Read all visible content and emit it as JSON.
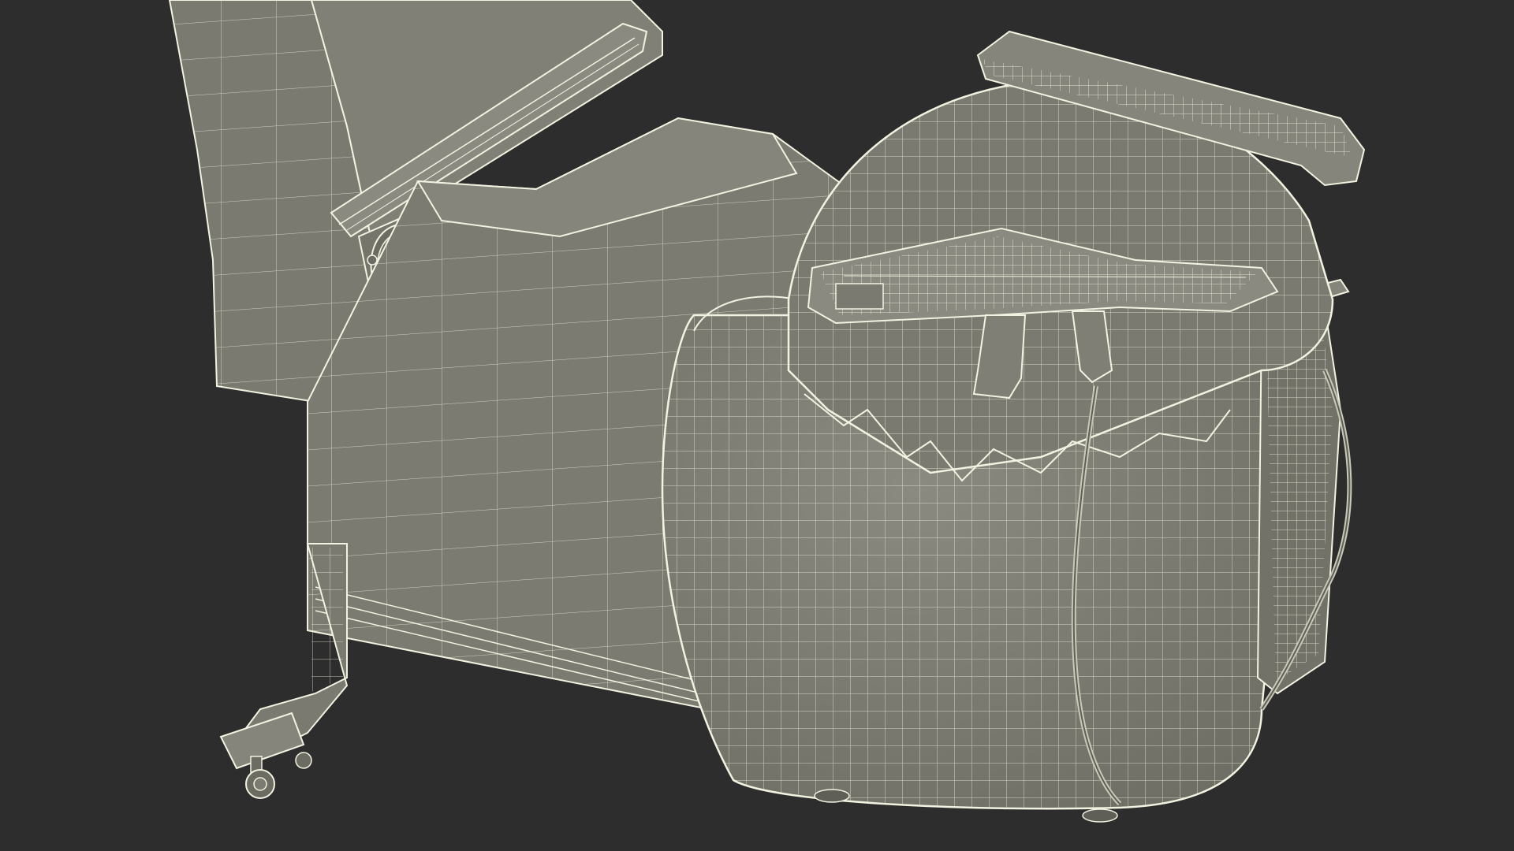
{
  "scene": {
    "subject": "arcade-shooter-cabinet-wireframe",
    "background_color": "#2d2d2d",
    "surface_color": "#7d7d73",
    "surface_dark_color": "#6c6c63",
    "surface_light_color": "#8c8c82",
    "wire_color": "#f2f2e0",
    "hose_color": "#c9c9b8"
  }
}
